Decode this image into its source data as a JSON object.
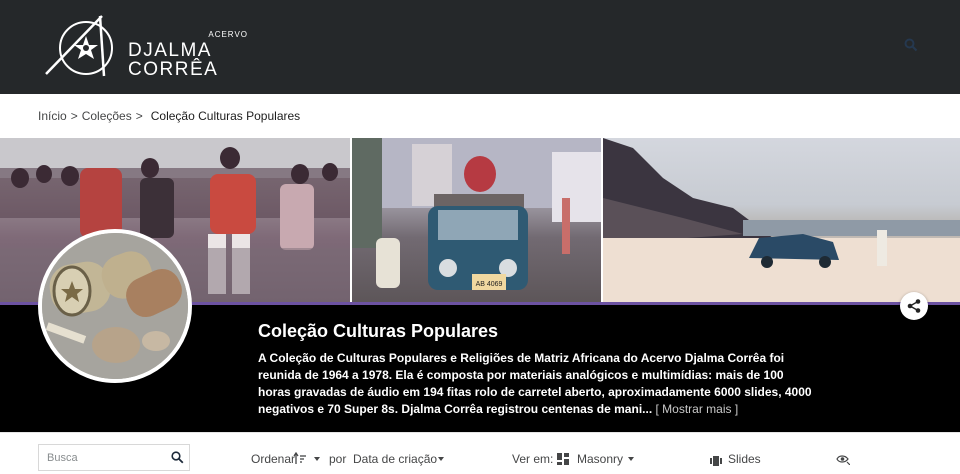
{
  "header": {
    "logo_small": "ACERVO",
    "logo_line1": "DJALMA",
    "logo_line2": "CORRÊA"
  },
  "breadcrumb": {
    "home": "Início",
    "sep": ">",
    "collections": "Coleções",
    "current": "Coleção Culturas Populares"
  },
  "collection": {
    "title": "Coleção Culturas Populares",
    "description": "A Coleção de Culturas Populares e Religiões de Matriz Africana do Acervo Djalma Corrêa foi reunida de 1964 a 1978. Ela é composta por materiais analógicos e multimídias: mais de 100 horas gravadas de áudio em 194 fitas rolo de carretel aberto, aproximadamente 6000 slides, 4000 negativos e 70 Super 8s. Djalma Corrêa registrou centenas de mani...",
    "more_label": "[ Mostrar mais ]",
    "plate": "AB 4069"
  },
  "toolbar": {
    "search_placeholder": "Busca",
    "sort_label": "Ordenar",
    "by_label": "por",
    "sort_field": "Data de criação",
    "view_label": "Ver em:",
    "view_mode": "Masonry",
    "slides_label": "Slides"
  },
  "colors": {
    "header_bg": "#25282a",
    "accent": "#6c52a1",
    "info_bg": "#000000"
  }
}
